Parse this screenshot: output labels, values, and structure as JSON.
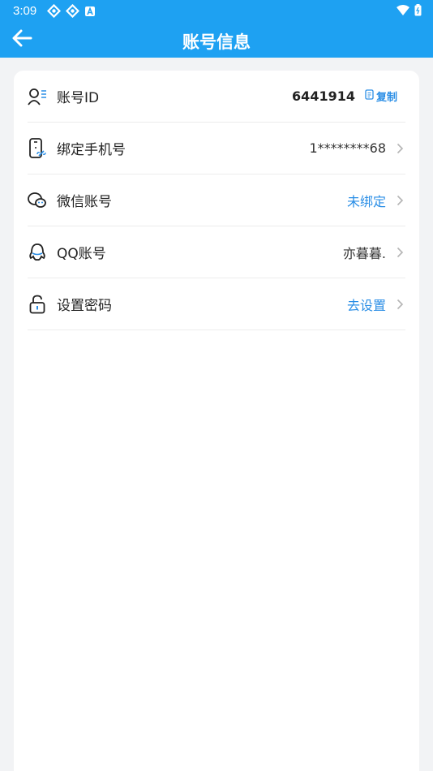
{
  "status_bar": {
    "time": "3:09",
    "icons": [
      "sync-icon",
      "sync-icon",
      "text-a-icon"
    ],
    "right_icons": [
      "wifi-icon",
      "battery-icon"
    ]
  },
  "header": {
    "title": "账号信息",
    "back_icon": "arrow-left-icon"
  },
  "rows": [
    {
      "icon": "user-list-icon",
      "label": "账号ID",
      "value": "6441914",
      "action": "复制"
    },
    {
      "icon": "phone-link-icon",
      "label": "绑定手机号",
      "value": "1********68"
    },
    {
      "icon": "wechat-icon",
      "label": "微信账号",
      "value": "未绑定"
    },
    {
      "icon": "qq-icon",
      "label": "QQ账号",
      "value": "亦暮暮."
    },
    {
      "icon": "lock-icon",
      "label": "设置密码",
      "value": "去设置"
    }
  ],
  "colors": {
    "brand": "#1ea1f2",
    "link": "#2a8ee6",
    "background": "#f2f3f5"
  }
}
